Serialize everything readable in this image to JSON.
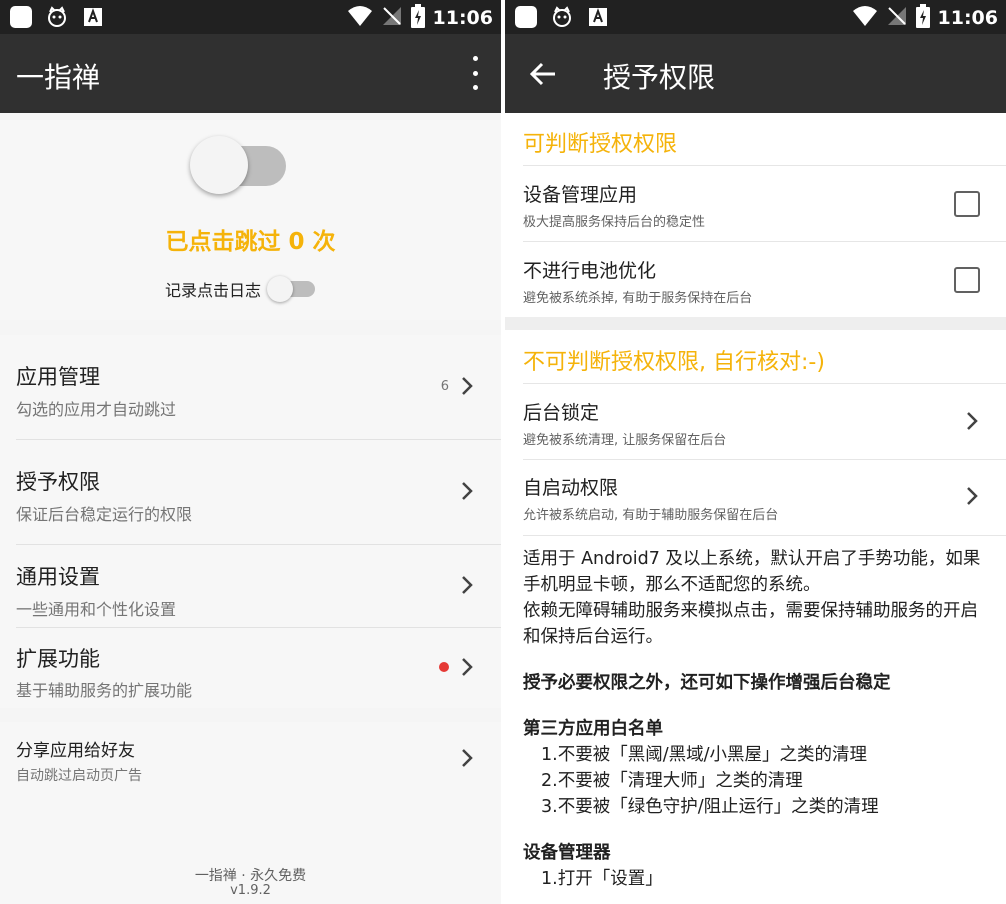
{
  "status_bar": {
    "time": "11:06"
  },
  "left": {
    "toolbar": {
      "title": "一指禅"
    },
    "skip_count_text": "已点击跳过 0 次",
    "log_label": "记录点击日志",
    "menu": [
      {
        "title": "应用管理",
        "subtitle": "勾选的应用才自动跳过",
        "count": "6"
      },
      {
        "title": "授予权限",
        "subtitle": "保证后台稳定运行的权限"
      },
      {
        "title": "通用设置",
        "subtitle": "一些通用和个性化设置"
      },
      {
        "title": "扩展功能",
        "subtitle": "基于辅助服务的扩展功能"
      }
    ],
    "share": {
      "title": "分享应用给好友",
      "subtitle": "自动跳过启动页广告"
    },
    "footer": {
      "line1": "一指禅 · 永久免费",
      "line2": "v1.9.2"
    }
  },
  "right": {
    "toolbar": {
      "title": "授予权限"
    },
    "section1": {
      "title": "可判断授权权限",
      "items": [
        {
          "title": "设备管理应用",
          "subtitle": "极大提高服务保持后台的稳定性"
        },
        {
          "title": "不进行电池优化",
          "subtitle": "避免被系统杀掉, 有助于服务保持在后台"
        }
      ]
    },
    "section2": {
      "title": "不可判断授权权限, 自行核对:-)",
      "items": [
        {
          "title": "后台锁定",
          "subtitle": "避免被系统清理, 让服务保留在后台"
        },
        {
          "title": "自启动权限",
          "subtitle": "允许被系统启动, 有助于辅助服务保留在后台"
        }
      ]
    },
    "description": {
      "para1": "适用于 Android7 及以上系统，默认开启了手势功能，如果手机明显卡顿，那么不适配您的系统。",
      "para2": "依赖无障碍辅助服务来模拟点击，需要保持辅助服务的开启和保持后台运行。",
      "bold_line": "授予必要权限之外，还可如下操作增强后台稳定",
      "whitelist_title": "第三方应用白名单",
      "whitelist": [
        "1.不要被「黑阈/黑域/小黑屋」之类的清理",
        "2.不要被「清理大师」之类的清理",
        "3.不要被「绿色守护/阻止运行」之类的清理"
      ],
      "device_admin_title": "设备管理器",
      "device_admin_steps": [
        "1.打开「设置」"
      ]
    }
  }
}
